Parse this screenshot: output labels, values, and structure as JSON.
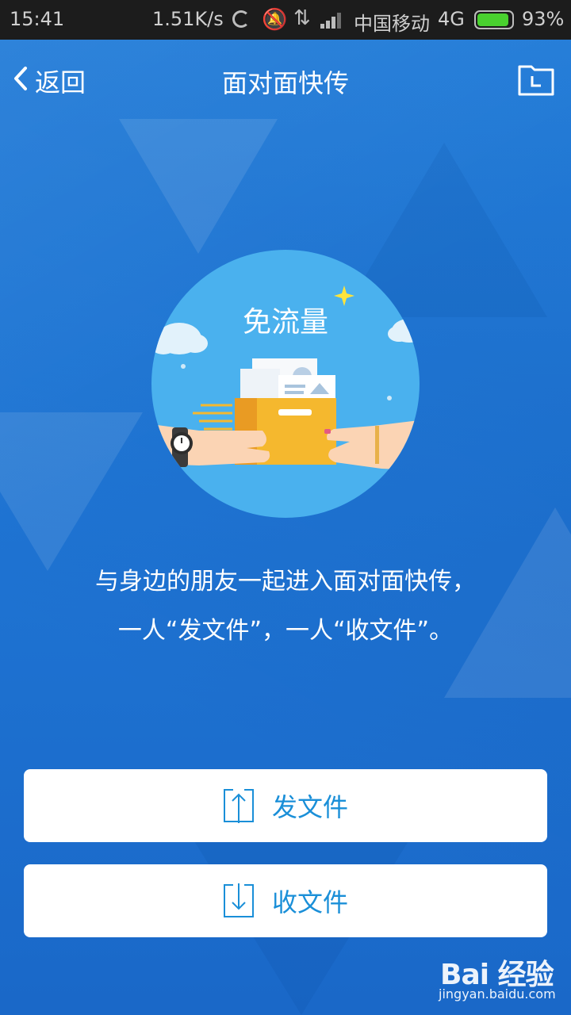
{
  "statusbar": {
    "time": "15:41",
    "speed": "1.51K/s",
    "carrier": "中国移动",
    "network": "4G",
    "battery": "93%",
    "battery_level": 0.93,
    "battery_color": "#49d12f"
  },
  "header": {
    "back_label": "返回",
    "title": "面对面快传",
    "folder_icon": "folder-icon"
  },
  "hero": {
    "badge_text": "免流量",
    "circle_color": "#4ab1ee"
  },
  "description": {
    "line1": "与身边的朋友一起进入面对面快传，",
    "line2": "一人“发文件”，一人“收文件”。"
  },
  "actions": {
    "send_label": "发文件",
    "receive_label": "收文件",
    "accent_color": "#1a8fd8"
  },
  "watermark": {
    "logo": "Bai 经验",
    "url": "jingyan.baidu.com"
  }
}
